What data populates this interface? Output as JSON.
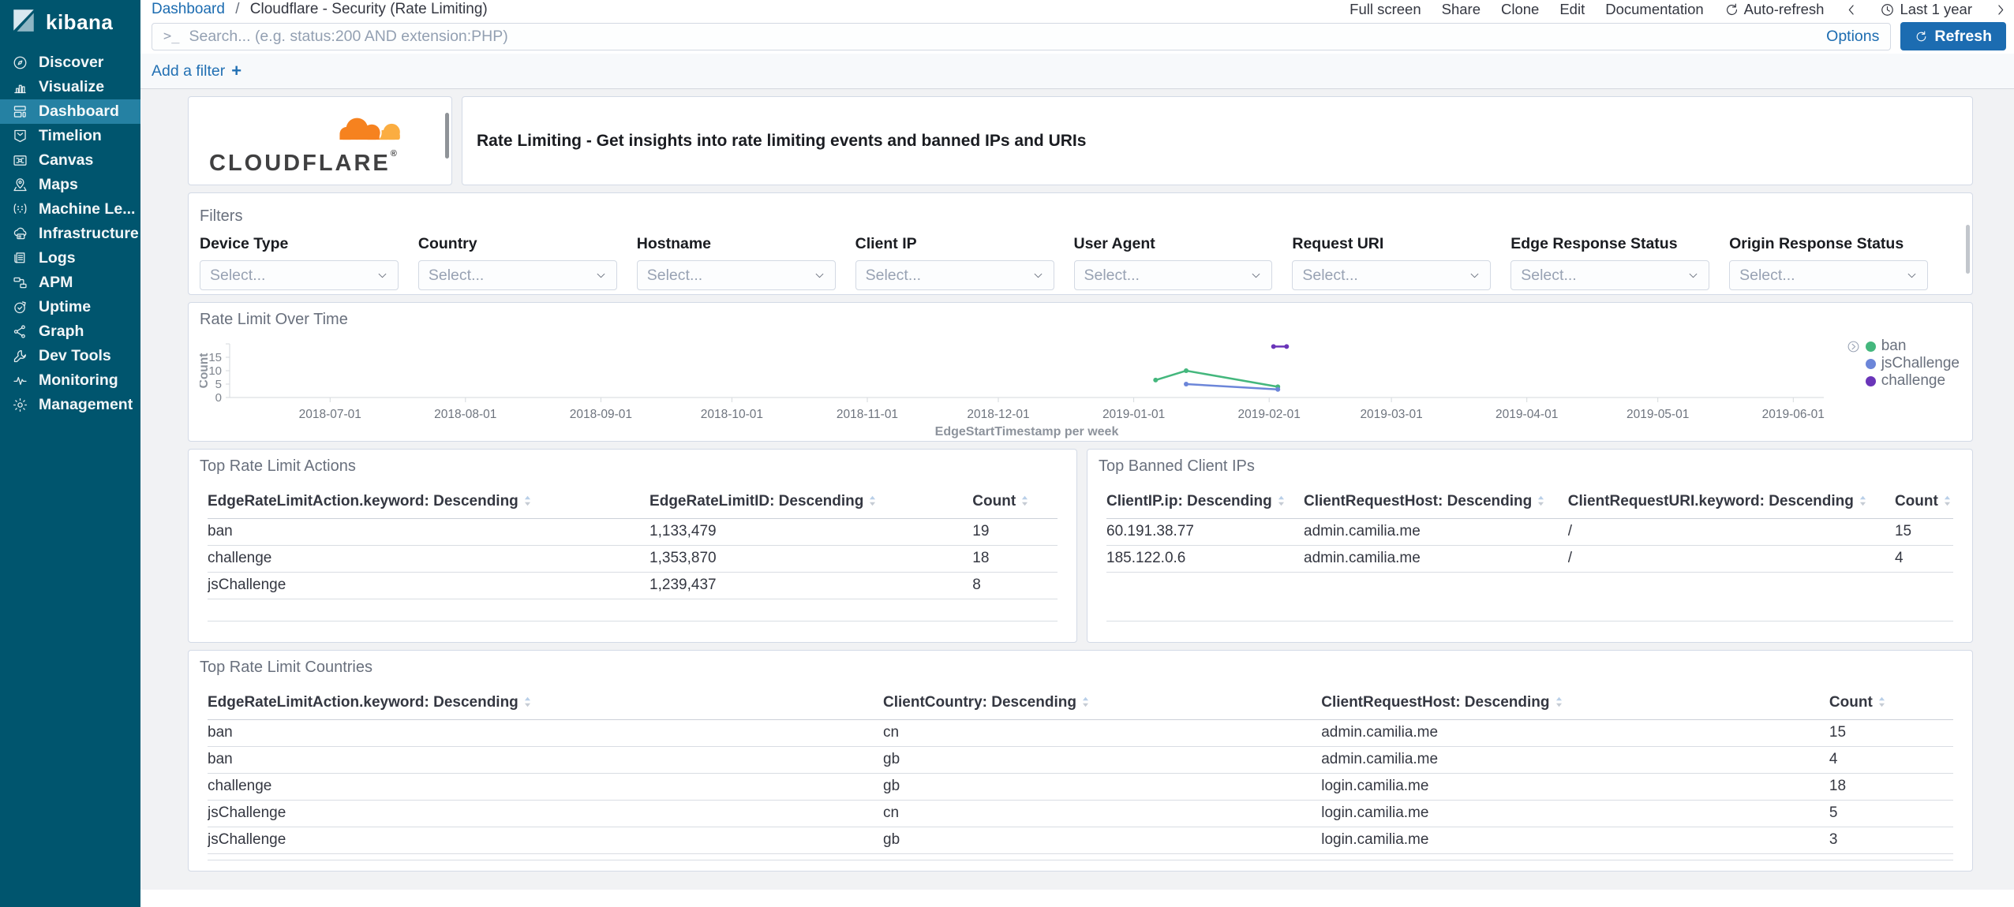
{
  "sidebar": {
    "logo_text": "kibana",
    "items": [
      {
        "label": "Discover",
        "icon": "discover-icon",
        "active": false
      },
      {
        "label": "Visualize",
        "icon": "visualize-icon",
        "active": false
      },
      {
        "label": "Dashboard",
        "icon": "dashboard-icon",
        "active": true
      },
      {
        "label": "Timelion",
        "icon": "timelion-icon",
        "active": false
      },
      {
        "label": "Canvas",
        "icon": "canvas-icon",
        "active": false
      },
      {
        "label": "Maps",
        "icon": "maps-icon",
        "active": false
      },
      {
        "label": "Machine Le...",
        "icon": "machine-learning-icon",
        "active": false
      },
      {
        "label": "Infrastructure",
        "icon": "infrastructure-icon",
        "active": false
      },
      {
        "label": "Logs",
        "icon": "logs-icon",
        "active": false
      },
      {
        "label": "APM",
        "icon": "apm-icon",
        "active": false
      },
      {
        "label": "Uptime",
        "icon": "uptime-icon",
        "active": false
      },
      {
        "label": "Graph",
        "icon": "graph-icon",
        "active": false
      },
      {
        "label": "Dev Tools",
        "icon": "dev-tools-icon",
        "active": false
      },
      {
        "label": "Monitoring",
        "icon": "monitoring-icon",
        "active": false
      },
      {
        "label": "Management",
        "icon": "management-icon",
        "active": false
      }
    ]
  },
  "topbar": {
    "breadcrumb": {
      "root": "Dashboard",
      "separator": "/",
      "current": "Cloudflare - Security (Rate Limiting)"
    },
    "actions": [
      "Full screen",
      "Share",
      "Clone",
      "Edit",
      "Documentation"
    ],
    "auto_refresh_label": "Auto-refresh",
    "time_range_label": "Last 1 year"
  },
  "query_bar": {
    "prompt": ">_",
    "placeholder": "Search... (e.g. status:200 AND extension:PHP)",
    "value": "",
    "options_label": "Options",
    "refresh_label": "Refresh"
  },
  "filter_bar": {
    "add_filter_label": "Add a filter",
    "plus": "+"
  },
  "branding": {
    "wordmark": "CLOUDFLARE",
    "registered_mark": "®",
    "cloud_primary": "#f6821f",
    "cloud_secondary": "#fbad41"
  },
  "header_panel": {
    "title": "Rate Limiting - Get insights into rate limiting events and banned IPs and URIs"
  },
  "filters_panel": {
    "title": "Filters",
    "select_placeholder": "Select...",
    "fields": [
      "Device Type",
      "Country",
      "Hostname",
      "Client IP",
      "User Agent",
      "Request URI",
      "Edge Response Status",
      "Origin Response Status"
    ]
  },
  "chart_data": {
    "type": "line",
    "title": "Rate Limit Over Time",
    "xlabel": "EdgeStartTimestamp per week",
    "ylabel": "Count",
    "xlim": [
      "2018-06-08",
      "2019-06-08"
    ],
    "ylim": [
      0,
      20
    ],
    "yticks": [
      0,
      5,
      10,
      15
    ],
    "xticks": [
      "2018-07-01",
      "2018-08-01",
      "2018-09-01",
      "2018-10-01",
      "2018-11-01",
      "2018-12-01",
      "2019-01-01",
      "2019-02-01",
      "2019-03-01",
      "2019-04-01",
      "2019-05-01",
      "2019-06-01"
    ],
    "grid": false,
    "legend_position": "right",
    "series": [
      {
        "name": "ban",
        "color": "#44b77d",
        "points": [
          [
            "2019-01-06",
            6.5
          ],
          [
            "2019-01-13",
            10
          ],
          [
            "2019-02-03",
            4
          ]
        ]
      },
      {
        "name": "jsChallenge",
        "color": "#6c86d9",
        "points": [
          [
            "2019-01-13",
            5
          ],
          [
            "2019-02-03",
            3
          ]
        ]
      },
      {
        "name": "challenge",
        "color": "#6a35b9",
        "points": [
          [
            "2019-02-02",
            19
          ],
          [
            "2019-02-05",
            19
          ]
        ]
      }
    ]
  },
  "tables": {
    "actions": {
      "title": "Top Rate Limit Actions",
      "columns": [
        "EdgeRateLimitAction.keyword: Descending",
        "EdgeRateLimitID: Descending",
        "Count"
      ],
      "rows": [
        [
          "ban",
          "1,133,479",
          "19"
        ],
        [
          "challenge",
          "1,353,870",
          "18"
        ],
        [
          "jsChallenge",
          "1,239,437",
          "8"
        ]
      ]
    },
    "banned_ips": {
      "title": "Top Banned Client IPs",
      "columns": [
        "ClientIP.ip: Descending",
        "ClientRequestHost: Descending",
        "ClientRequestURI.keyword: Descending",
        "Count"
      ],
      "rows": [
        [
          "60.191.38.77",
          "admin.camilia.me",
          "/",
          "15"
        ],
        [
          "185.122.0.6",
          "admin.camilia.me",
          "/",
          "4"
        ]
      ]
    },
    "countries": {
      "title": "Top Rate Limit Countries",
      "columns": [
        "EdgeRateLimitAction.keyword: Descending",
        "ClientCountry: Descending",
        "ClientRequestHost: Descending",
        "Count"
      ],
      "rows": [
        [
          "ban",
          "cn",
          "admin.camilia.me",
          "15"
        ],
        [
          "ban",
          "gb",
          "admin.camilia.me",
          "4"
        ],
        [
          "challenge",
          "gb",
          "login.camilia.me",
          "18"
        ],
        [
          "jsChallenge",
          "cn",
          "login.camilia.me",
          "5"
        ],
        [
          "jsChallenge",
          "gb",
          "login.camilia.me",
          "3"
        ]
      ]
    }
  },
  "colors": {
    "accent_blue": "#1c6cb1",
    "sidebar": "#00556e",
    "sidebar_active": "#2581a3",
    "ban_green": "#44b77d",
    "jschallenge_blue": "#6c86d9",
    "challenge_purple": "#6a35b9"
  }
}
